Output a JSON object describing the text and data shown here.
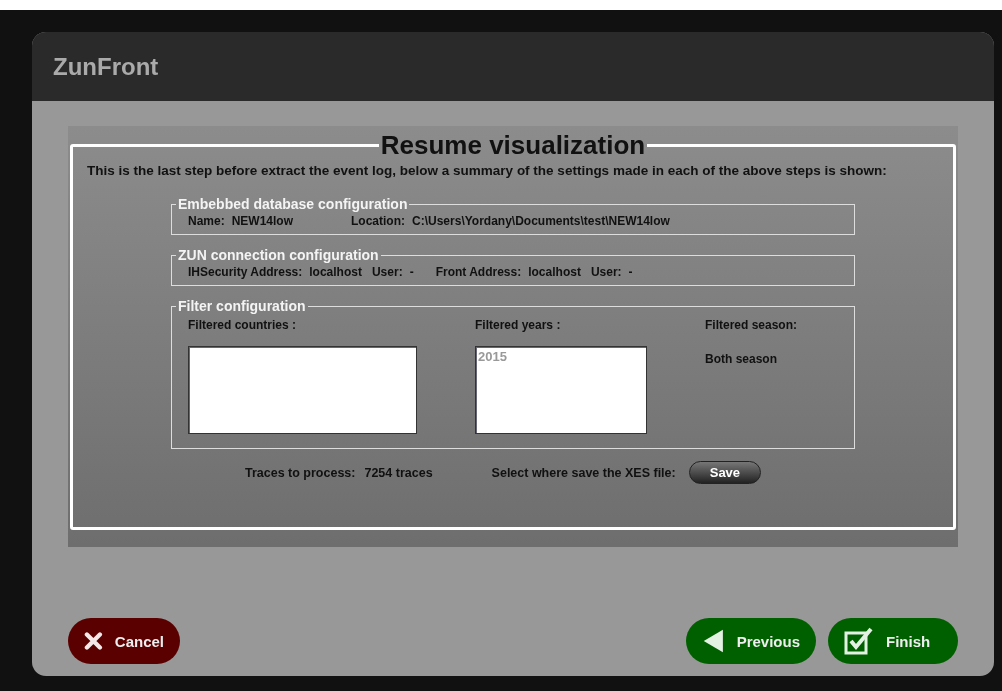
{
  "window": {
    "title": "ZunFront"
  },
  "panel": {
    "title": "Resume visualization",
    "intro": "This is the last step before extract the event log, below a summary of the settings made in each of the above steps is shown:"
  },
  "sections": [
    {
      "kind": "fields",
      "title": "Embebbed database configuration",
      "fields": [
        {
          "label": "Name:",
          "value": "NEW14low"
        },
        {
          "label": "Location:",
          "value": "C:\\Users\\Yordany\\Documents\\test\\NEW14low"
        }
      ]
    },
    {
      "kind": "fields",
      "title": "ZUN connection configuration",
      "fields": [
        {
          "label": "IHSecurity Address:",
          "value": "localhost"
        },
        {
          "label": "User:",
          "value": "-"
        },
        {
          "label": "Front Address:",
          "value": "localhost"
        },
        {
          "label": "User:",
          "value": "-"
        }
      ]
    },
    {
      "kind": "filters",
      "title": "Filter configuration",
      "filters": [
        {
          "kind": "list",
          "label": "Filtered countries :"
        },
        {
          "kind": "list",
          "label": "Filtered years :",
          "items": [
            "2015"
          ]
        },
        {
          "kind": "text",
          "label": "Filtered season:",
          "value": "Both season"
        }
      ]
    }
  ],
  "summary": {
    "traces_label": "Traces to process:",
    "traces_value": "7254 traces",
    "save_label": "Select where save the XES file:",
    "save_button": "Save"
  },
  "buttons": [
    {
      "kind": "cancel",
      "label": "Cancel"
    },
    {
      "kind": "previous",
      "label": "Previous"
    },
    {
      "kind": "finish",
      "label": "Finish"
    }
  ]
}
